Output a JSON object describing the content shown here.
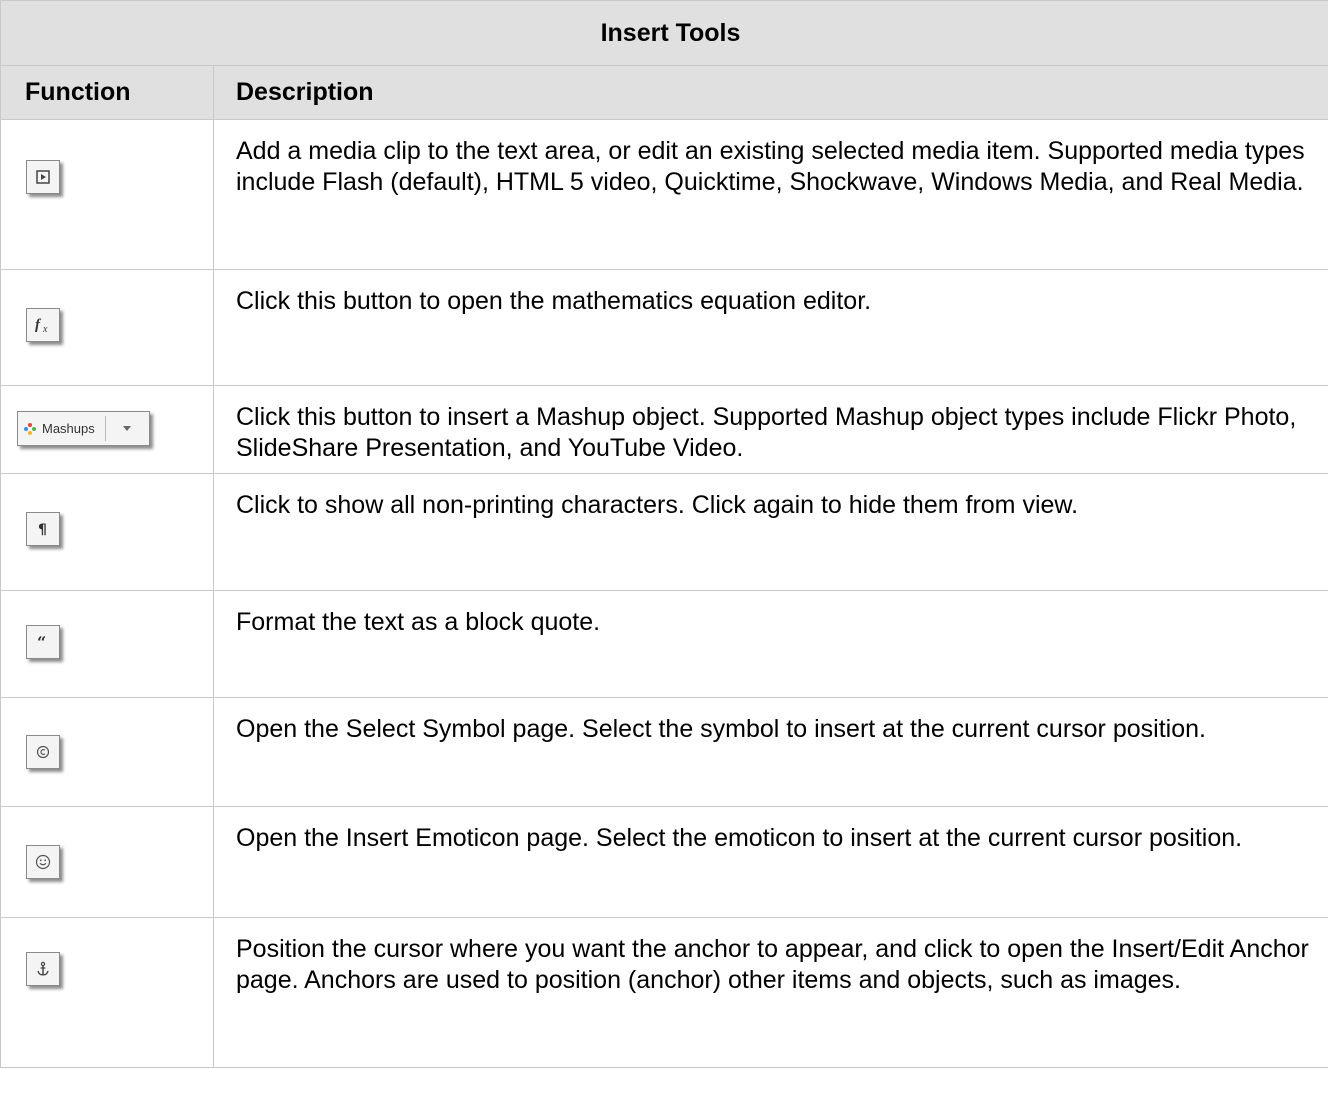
{
  "table": {
    "title": "Insert Tools",
    "headers": {
      "function": "Function",
      "description": "Description"
    },
    "rows": [
      {
        "icon": "media-clip-icon",
        "description": "Add a media clip to the text area, or edit an existing selected media item. Supported media types include Flash (default), HTML 5 video, Quicktime, Shockwave, Windows Media, and Real Media."
      },
      {
        "icon": "equation-fx-icon",
        "description": "Click this button to open the mathematics equation editor."
      },
      {
        "icon": "mashups-icon",
        "button_label": "Mashups",
        "description": "Click this button to insert a Mashup object. Supported Mashup object types include Flickr Photo, SlideShare Presentation, and YouTube Video."
      },
      {
        "icon": "pilcrow-icon",
        "description": "Click to show all non-printing characters. Click again to hide them from view."
      },
      {
        "icon": "block-quote-icon",
        "description": "Format the text as a block quote."
      },
      {
        "icon": "copyright-symbol-icon",
        "description": "Open the Select Symbol page. Select the symbol to insert at the current cursor position."
      },
      {
        "icon": "smiley-emoticon-icon",
        "description": "Open the Insert Emoticon page. Select the emoticon to insert at the current cursor position."
      },
      {
        "icon": "anchor-icon",
        "description": "Position the cursor where you want the anchor to appear, and click to open the Insert/Edit Anchor page. Anchors are used to position (anchor) other items and objects, such as images."
      }
    ]
  },
  "colors": {
    "header_bg": "#e0e0e0",
    "border": "#c8c8c8"
  }
}
